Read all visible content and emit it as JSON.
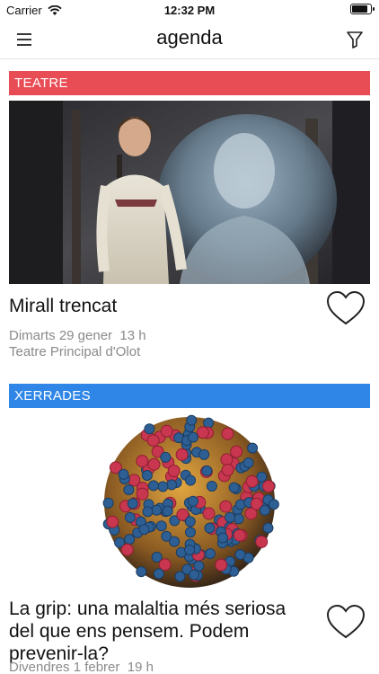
{
  "status_bar": {
    "carrier": "Carrier",
    "time": "12:32 PM",
    "battery_level": 0.9
  },
  "nav": {
    "title": "agenda",
    "menu_icon": "hamburger-icon",
    "filter_icon": "filter-icon"
  },
  "events": [
    {
      "category": "TEATRE",
      "category_color": "#e84c55",
      "title": "Mirall trencat",
      "date": "Dimarts 29 gener",
      "time": "13 h",
      "venue": "Teatre Principal d'Olot",
      "favorite_icon": "heart-outline-icon"
    },
    {
      "category": "XERRADES",
      "category_color": "#2f86e6",
      "title": "La grip: una malaltia més seriosa del que ens pensem. Podem prevenir-la?",
      "date": "Divendres 1 febrer",
      "time": "19 h",
      "favorite_icon": "heart-outline-icon"
    }
  ]
}
